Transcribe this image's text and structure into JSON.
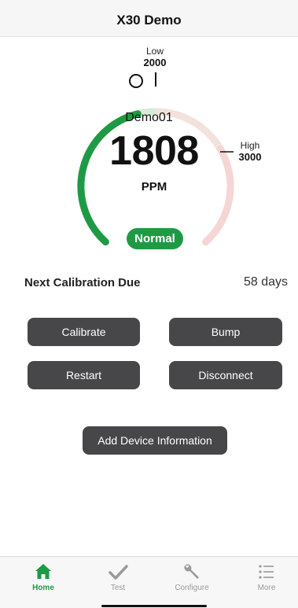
{
  "header": {
    "title": "X30 Demo"
  },
  "gauge": {
    "device_name": "Demo01",
    "reading": "1808",
    "unit": "PPM",
    "low_label": "Low",
    "low_value": "2000",
    "high_label": "High",
    "high_value": "3000",
    "fill_fraction": 0.45,
    "colors": {
      "active": "#1e9a45",
      "low_zone": "#d5ecd9",
      "high_zone": "#f5d6d6",
      "neutral": "#f3e6e0"
    }
  },
  "status": {
    "label": "Normal",
    "color": "#1e9a45"
  },
  "calibration": {
    "label": "Next Calibration Due",
    "value": "58 days"
  },
  "actions": {
    "calibrate": "Calibrate",
    "bump": "Bump",
    "restart": "Restart",
    "disconnect": "Disconnect",
    "add_info": "Add Device Information"
  },
  "tabs": [
    {
      "label": "Home",
      "icon": "home-icon",
      "active": true
    },
    {
      "label": "Test",
      "icon": "checkmark-icon",
      "active": false
    },
    {
      "label": "Configure",
      "icon": "wrench-icon",
      "active": false
    },
    {
      "label": "More",
      "icon": "list-icon",
      "active": false
    }
  ],
  "colors": {
    "button_bg": "#47474a",
    "accent": "#1e9a45",
    "tab_inactive": "#9a9a9a"
  }
}
